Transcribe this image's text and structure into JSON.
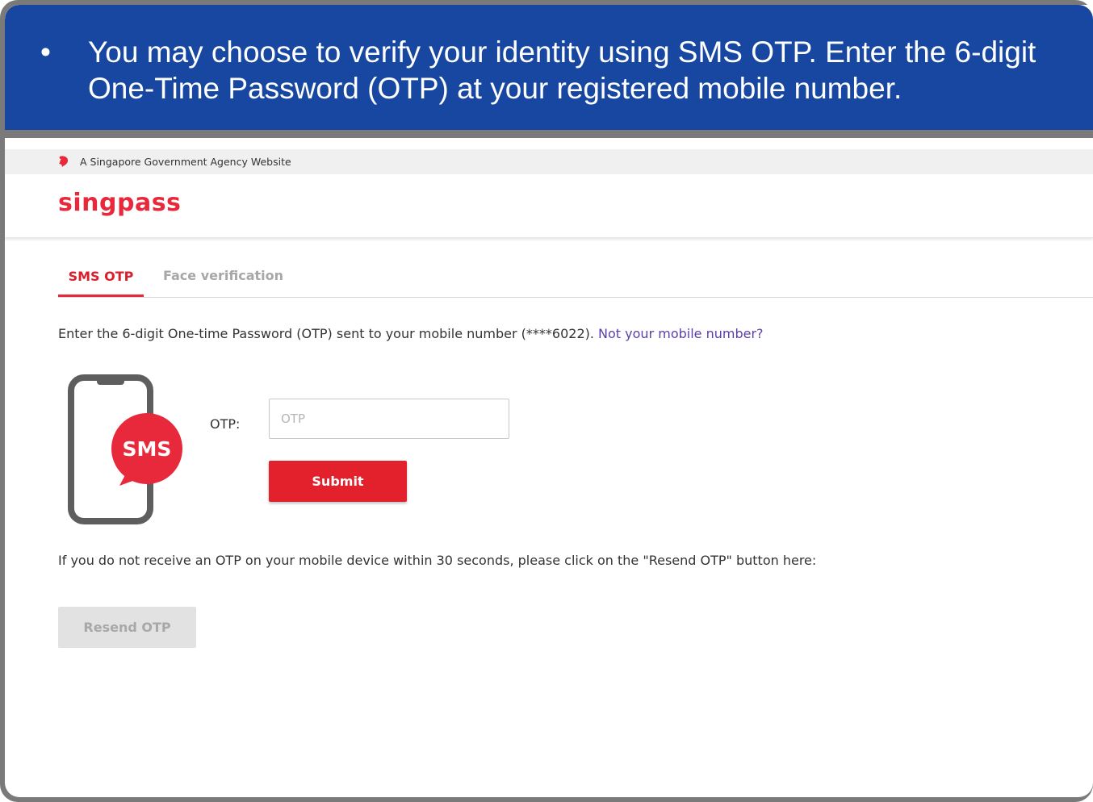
{
  "banner": {
    "bullet": "•",
    "text": "You may choose to verify your identity using SMS OTP. Enter the 6-digit One-Time Password (OTP) at your registered mobile number."
  },
  "gov_bar": {
    "text": "A Singapore Government Agency Website",
    "icon": "lion-head-icon"
  },
  "header": {
    "logo": "singpass"
  },
  "tabs": [
    {
      "label": "SMS OTP",
      "active": true
    },
    {
      "label": "Face verification",
      "active": false
    }
  ],
  "instructions": {
    "text": "Enter the 6-digit One-time Password (OTP) sent to your mobile number (****6022).",
    "link": "Not your mobile number?"
  },
  "sms_icon": {
    "label": "SMS",
    "icon": "phone-sms-icon"
  },
  "otp": {
    "label": "OTP:",
    "value": "",
    "placeholder": "OTP",
    "submit_label": "Submit"
  },
  "resend": {
    "info": "If you do not receive an OTP on your mobile device within 30 seconds, please click on the \"Resend OTP\" button here:",
    "button_label": "Resend OTP"
  },
  "colors": {
    "banner": "#1747a0",
    "brand_red": "#e8293b",
    "link_purple": "#5b3fa8",
    "disabled_gray": "#e2e2e2"
  }
}
